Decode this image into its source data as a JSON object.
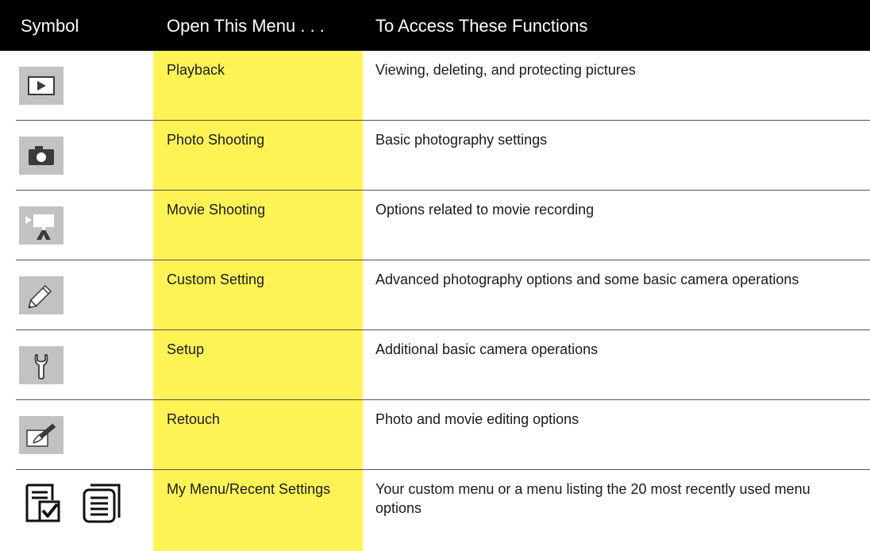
{
  "header": {
    "symbol": "Symbol",
    "menu": "Open This Menu . . .",
    "functions": "To Access These Functions"
  },
  "colors": {
    "header_bg": "#000000",
    "highlight": "#fef354",
    "icon_bg": "#c2c2c2"
  },
  "rows": [
    {
      "icon": "playback-icon",
      "menu": "Playback",
      "functions": "Viewing, deleting, and protecting pictures"
    },
    {
      "icon": "camera-icon",
      "menu": "Photo Shooting",
      "functions": "Basic photography settings"
    },
    {
      "icon": "movie-camera-icon",
      "menu": "Movie Shooting",
      "functions": "Options related to movie recording"
    },
    {
      "icon": "pencil-icon",
      "menu": "Custom Setting",
      "functions": "Advanced photography options and some basic camera operations"
    },
    {
      "icon": "wrench-icon",
      "menu": "Setup",
      "functions": "Additional basic camera operations"
    },
    {
      "icon": "retouch-brush-icon",
      "menu": "Retouch",
      "functions": "Photo and movie editing options"
    },
    {
      "icon": "my-menu-icon, recent-settings-icon",
      "menu": "My Menu/Recent Settings",
      "functions": "Your custom menu or a menu listing the 20 most recently used menu options"
    }
  ]
}
